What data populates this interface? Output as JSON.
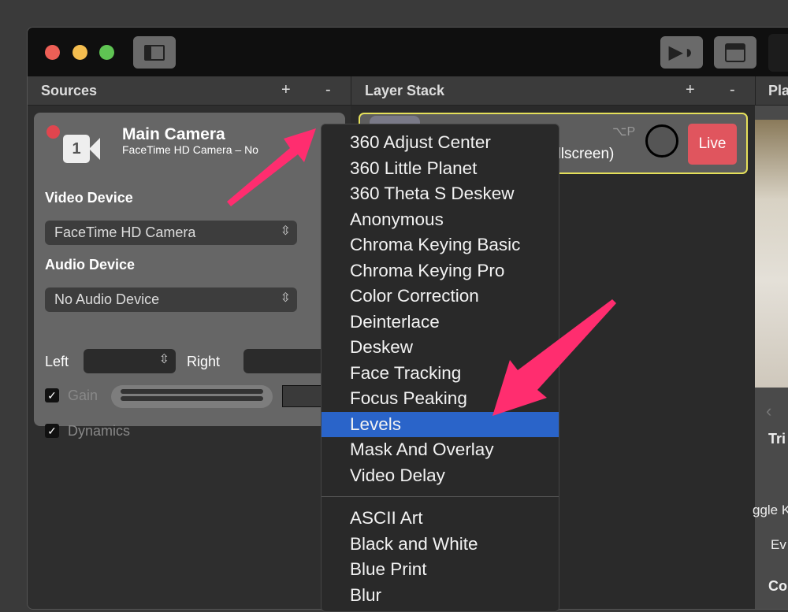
{
  "window": {
    "traffic_lights": {
      "close": "#ed5f56",
      "minimize": "#f4bd4f",
      "zoom": "#5fc453"
    }
  },
  "toolbar": {
    "sidebar_icon": "sidebar-icon",
    "broadcast_icon": "play-broadcast-icon",
    "clapper_icon": "clapperboard-icon"
  },
  "sources": {
    "title": "Sources",
    "add": "+",
    "remove": "-",
    "card": {
      "name": "Main Camera",
      "subtitle": "FaceTime HD Camera – No",
      "camera_badge": "1",
      "video_label": "Video Device",
      "video_value": "FaceTime HD Camera",
      "audio_label": "Audio Device",
      "audio_value": "No Audio Device",
      "left_label": "Left",
      "right_label": "Right",
      "gain_label": "Gain",
      "gain_checked": true,
      "dynamics_label": "Dynamics",
      "dynamics_checked": true
    }
  },
  "layer_stack": {
    "title": "Layer Stack",
    "add": "+",
    "remove": "-",
    "layer": {
      "subtitle": "ullscreen)",
      "shortcut": "⌥P",
      "live_label": "Live"
    }
  },
  "right_panel": {
    "title": "Pla",
    "section1": "Tri",
    "row1": "ggle K",
    "row2": "Ev",
    "section2": "Co"
  },
  "menu": {
    "group1": [
      "360 Adjust Center",
      "360 Little Planet",
      "360 Theta S Deskew",
      "Anonymous",
      "Chroma Keying Basic",
      "Chroma Keying Pro",
      "Color Correction",
      "Deinterlace",
      "Deskew",
      "Face Tracking",
      "Focus Peaking",
      "Levels",
      "Mask And Overlay",
      "Video Delay"
    ],
    "highlighted": "Levels",
    "group2": [
      "ASCII Art",
      "Black and White",
      "Blue Print",
      "Blur"
    ]
  },
  "colors": {
    "highlight": "#2a64c9",
    "live": "#e0555e",
    "annotation_arrow": "#ff2d6f",
    "layer_border": "#e5e05a"
  }
}
